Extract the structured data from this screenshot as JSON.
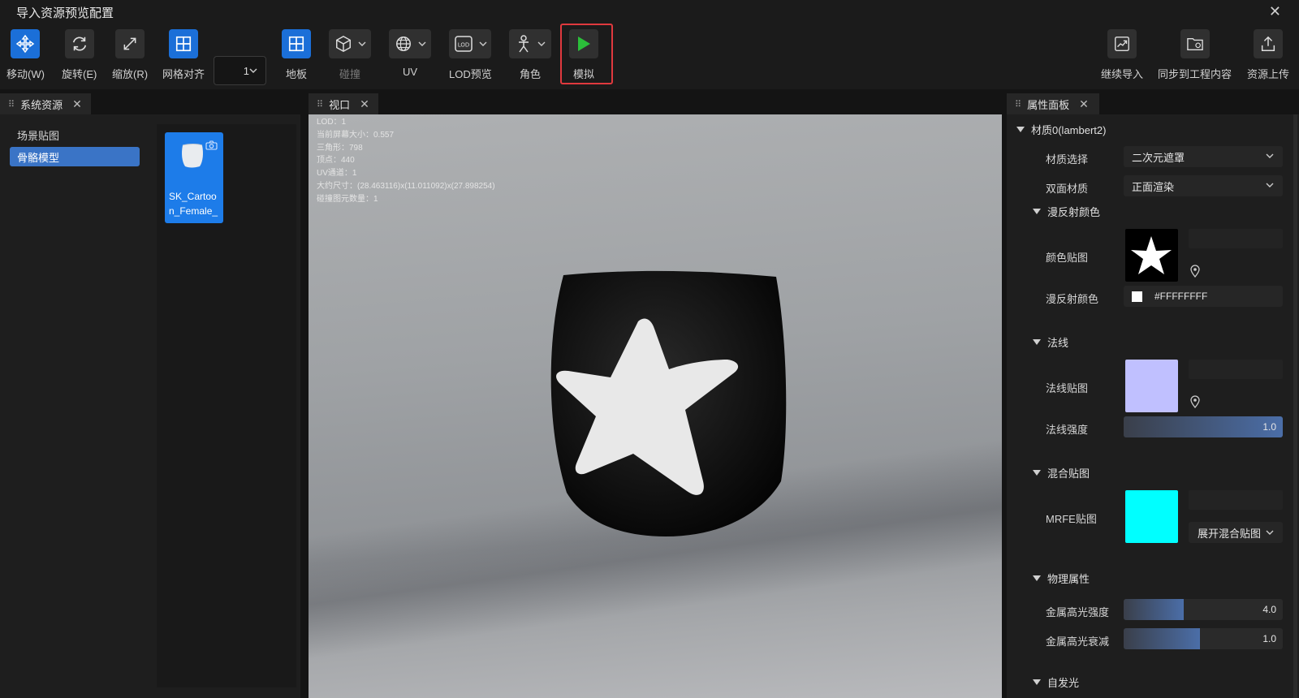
{
  "window": {
    "title": "导入资源预览配置"
  },
  "toolbar": {
    "move": "移动(W)",
    "rotate": "旋转(E)",
    "scale": "缩放(R)",
    "grid_snap": "网格对齐",
    "grid_value": "1",
    "floor": "地板",
    "collision": "碰撞",
    "uv": "UV",
    "lod_preview": "LOD预览",
    "character": "角色",
    "simulate": "模拟",
    "continue_import": "继续导入",
    "sync_project": "同步到工程内容",
    "upload": "资源上传"
  },
  "left_panel": {
    "tab": "系统资源",
    "tree": [
      "场景贴图",
      "骨骼模型"
    ],
    "selected_index": 1,
    "asset": {
      "name": "SK_Cartoon_Female_"
    }
  },
  "viewport": {
    "tab": "视口",
    "info": [
      "LOD：1",
      "当前屏幕大小：0.557",
      "三角形：798",
      "顶点：440",
      "UV通道：1",
      "大约尺寸：(28.463116)x(11.011092)x(27.898254)",
      "碰撞图元数量：1"
    ]
  },
  "props": {
    "tab": "属性面板",
    "material_header": "材质0(lambert2)",
    "material_select_label": "材质选择",
    "material_select_value": "二次元遮罩",
    "double_side_label": "双面材质",
    "double_side_value": "正面渲染",
    "diffuse_section": "漫反射颜色",
    "color_tex_label": "颜色贴图",
    "diffuse_color_label": "漫反射颜色",
    "diffuse_color_value": "#FFFFFFFF",
    "normal_section": "法线",
    "normal_tex_label": "法线贴图",
    "normal_strength_label": "法线强度",
    "normal_strength_value": "1.0",
    "normal_strength_fraction": 1.0,
    "blend_section": "混合贴图",
    "mrfe_label": "MRFE贴图",
    "expand_blend": "展开混合贴图",
    "physics_section": "物理属性",
    "metal_spec_label": "金属高光强度",
    "metal_spec_value": "4.0",
    "metal_spec_fraction": 0.38,
    "metal_falloff_label": "金属高光衰减",
    "metal_falloff_value": "1.0",
    "metal_falloff_fraction": 0.48,
    "emissive_section": "自发光"
  },
  "colors": {
    "accent": "#1b6fd8",
    "highlight_border": "#e0393e",
    "normal_tex": "#c0c0ff",
    "mrfe_tex": "#00ffff",
    "play_green": "#2bbf3a"
  }
}
